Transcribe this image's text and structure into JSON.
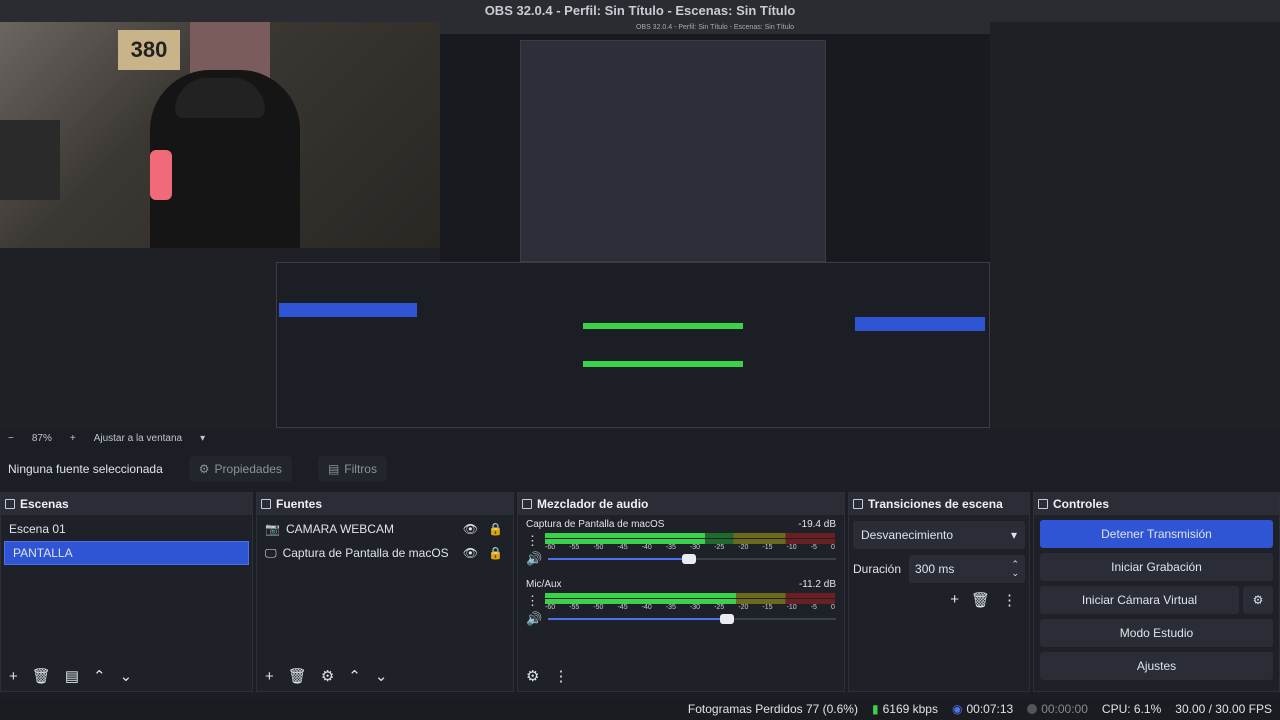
{
  "window": {
    "title": "OBS 32.0.4 - Perfil: Sin Título - Escenas: Sin Título"
  },
  "preview": {
    "poster_text": "380",
    "inner_title": "OBS 32.0.4 - Perfil: Sin Título - Escenas: Sin Título"
  },
  "zoom_bar": {
    "minus": "−",
    "zoom": "87%",
    "plus": "+",
    "fit_label": "Ajustar a la ventana"
  },
  "source_bar": {
    "no_source": "Ninguna fuente seleccionada",
    "properties_label": "Propiedades",
    "filters_label": "Filtros"
  },
  "scenes": {
    "title": "Escenas",
    "items": [
      {
        "label": "Escena 01",
        "selected": false
      },
      {
        "label": "PANTALLA",
        "selected": true
      }
    ]
  },
  "sources": {
    "title": "Fuentes",
    "items": [
      {
        "label": "CAMARA WEBCAM",
        "icon": "camera-icon"
      },
      {
        "label": "Captura de Pantalla de macOS",
        "icon": "monitor-icon"
      }
    ]
  },
  "mixer": {
    "title": "Mezclador de audio",
    "ticks": [
      "-60",
      "-55",
      "-50",
      "-45",
      "-40",
      "-35",
      "-30",
      "-25",
      "-20",
      "-15",
      "-10",
      "-5",
      "0"
    ],
    "channels": [
      {
        "name": "Captura de Pantalla de macOS",
        "db": "-19.4 dB",
        "level": 0.55,
        "volume": 0.49
      },
      {
        "name": "Mic/Aux",
        "db": "-11.2 dB",
        "level": 0.66,
        "volume": 0.62
      }
    ]
  },
  "transitions": {
    "title": "Transiciones de escena",
    "selected": "Desvanecimiento",
    "duration_label": "Duración",
    "duration_value": "300 ms"
  },
  "controls": {
    "title": "Controles",
    "stop_stream": "Detener Transmisión",
    "start_recording": "Iniciar Grabación",
    "start_virtual_cam": "Iniciar Cámara Virtual",
    "studio_mode": "Modo Estudio",
    "settings": "Ajustes"
  },
  "status": {
    "dropped_frames": "Fotogramas Perdidos 77 (0.6%)",
    "bitrate": "6169 kbps",
    "stream_time": "00:07:13",
    "record_time": "00:00:00",
    "cpu": "CPU: 6.1%",
    "fps": "30.00 / 30.00 FPS"
  },
  "colors": {
    "accent": "#2f55d4",
    "meter_green": "#3bd24b",
    "panel": "#1f2128"
  }
}
